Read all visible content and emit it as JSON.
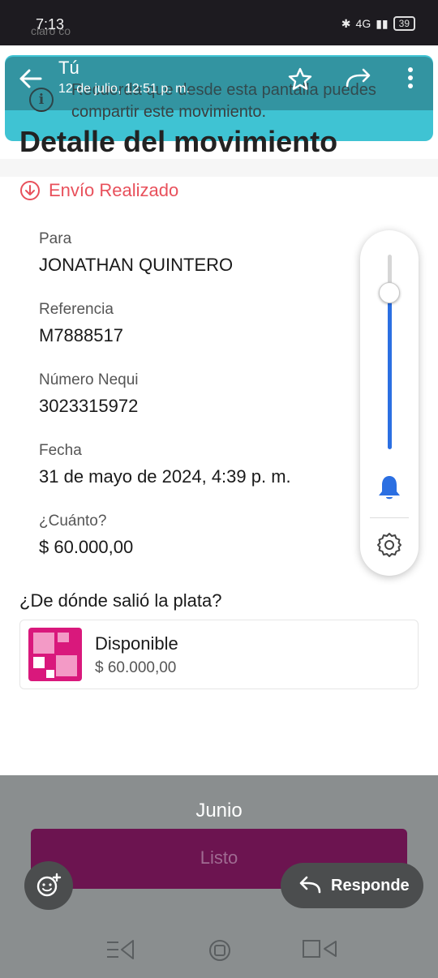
{
  "status_bar": {
    "time": "7:13",
    "carrier": "claro co",
    "network": "4G",
    "battery": "39"
  },
  "viewer": {
    "sender": "Tú",
    "date": "12 de julio, 12:51 p. m."
  },
  "banner": {
    "text": "Recuerda que desde esta pantalla puedes compartir este movimiento."
  },
  "page": {
    "title": "Detalle del movimiento",
    "status": "Envío Realizado"
  },
  "details": [
    {
      "label": "Para",
      "value": "JONATHAN QUINTERO"
    },
    {
      "label": "Referencia",
      "value": "M7888517"
    },
    {
      "label": "Número Nequi",
      "value": "3023315972"
    },
    {
      "label": "Fecha",
      "value": "31 de mayo de 2024, 4:39 p. m."
    },
    {
      "label": "¿Cuánto?",
      "value": "$ 60.000,00"
    }
  ],
  "source": {
    "title": "¿De dónde salió la plata?",
    "pocket_name": "Disponible",
    "pocket_amount": "$ 60.000,00"
  },
  "volume": {
    "level": 0.8
  },
  "footer": {
    "caption": "Junio",
    "listo_label": "Listo",
    "reply_label": "Responde"
  },
  "colors": {
    "accent_red": "#e8505b",
    "nequi_magenta": "#d9187c",
    "slider_blue": "#2b6fe2",
    "banner_teal": "#3fc3d3"
  }
}
